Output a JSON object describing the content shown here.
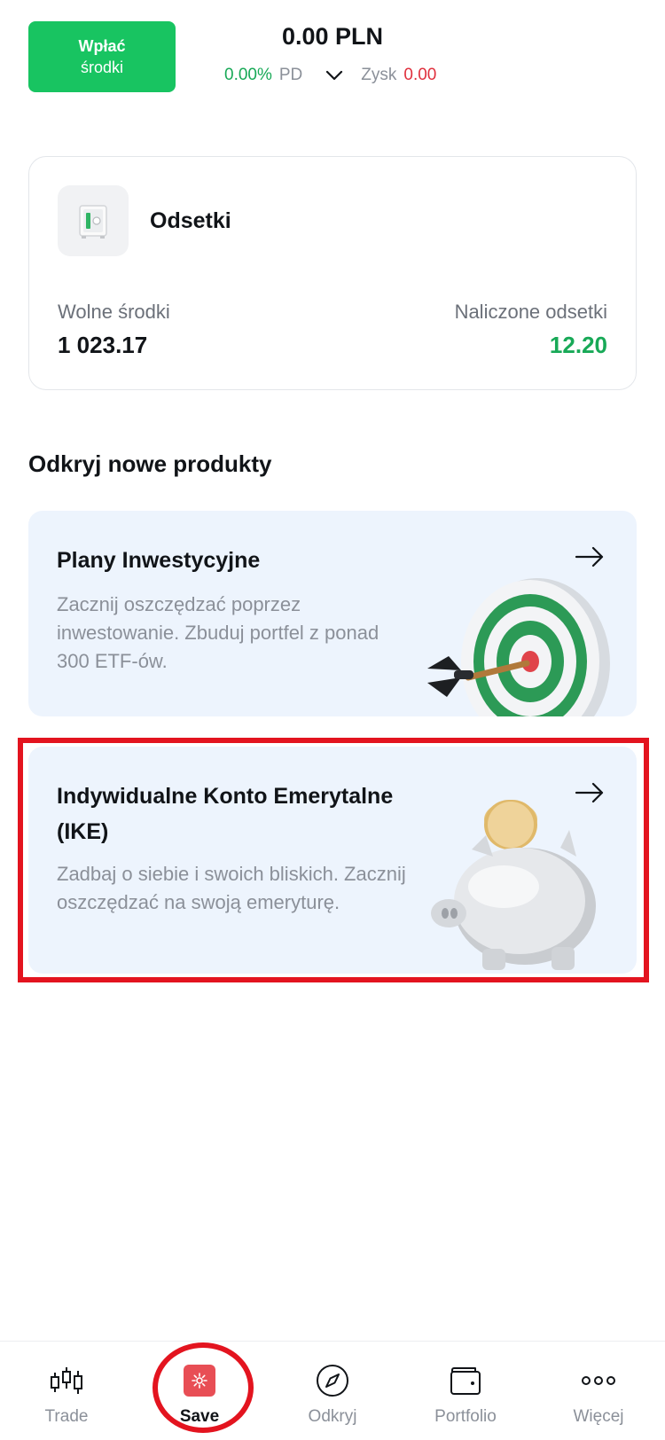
{
  "header": {
    "deposit_line1": "Wpłać",
    "deposit_line2": "środki",
    "balance": "0.00 PLN",
    "daily_change": "0.00%",
    "daily_label": "PD",
    "profit_label": "Zysk",
    "profit_value": "0.00"
  },
  "interest_card": {
    "title": "Odsetki",
    "free_funds_label": "Wolne środki",
    "free_funds_value": "1 023.17",
    "accrued_label": "Naliczone odsetki",
    "accrued_value": "12.20"
  },
  "discover": {
    "title": "Odkryj nowe produkty",
    "products": [
      {
        "title": "Plany Inwestycyjne",
        "description": "Zacznij oszczędzać poprzez inwestowanie. Zbuduj portfel z ponad 300 ETF-ów."
      },
      {
        "title": "Indywidualne Konto Emerytalne (IKE)",
        "description": "Zadbaj o siebie i swoich bliskich. Zacznij oszczędzać na swoją emeryturę."
      }
    ]
  },
  "bottom_nav": {
    "items": [
      {
        "label": "Trade",
        "icon": "candlestick-icon"
      },
      {
        "label": "Save",
        "icon": "safe-icon",
        "active": true
      },
      {
        "label": "Odkryj",
        "icon": "compass-icon"
      },
      {
        "label": "Portfolio",
        "icon": "wallet-icon"
      },
      {
        "label": "Więcej",
        "icon": "more-dots-icon"
      }
    ]
  },
  "colors": {
    "primary_green": "#18c461",
    "positive_text": "#18a957",
    "negative_text": "#e0303d",
    "product_card_bg": "#edf4fd",
    "highlight_red": "#e3141f"
  }
}
